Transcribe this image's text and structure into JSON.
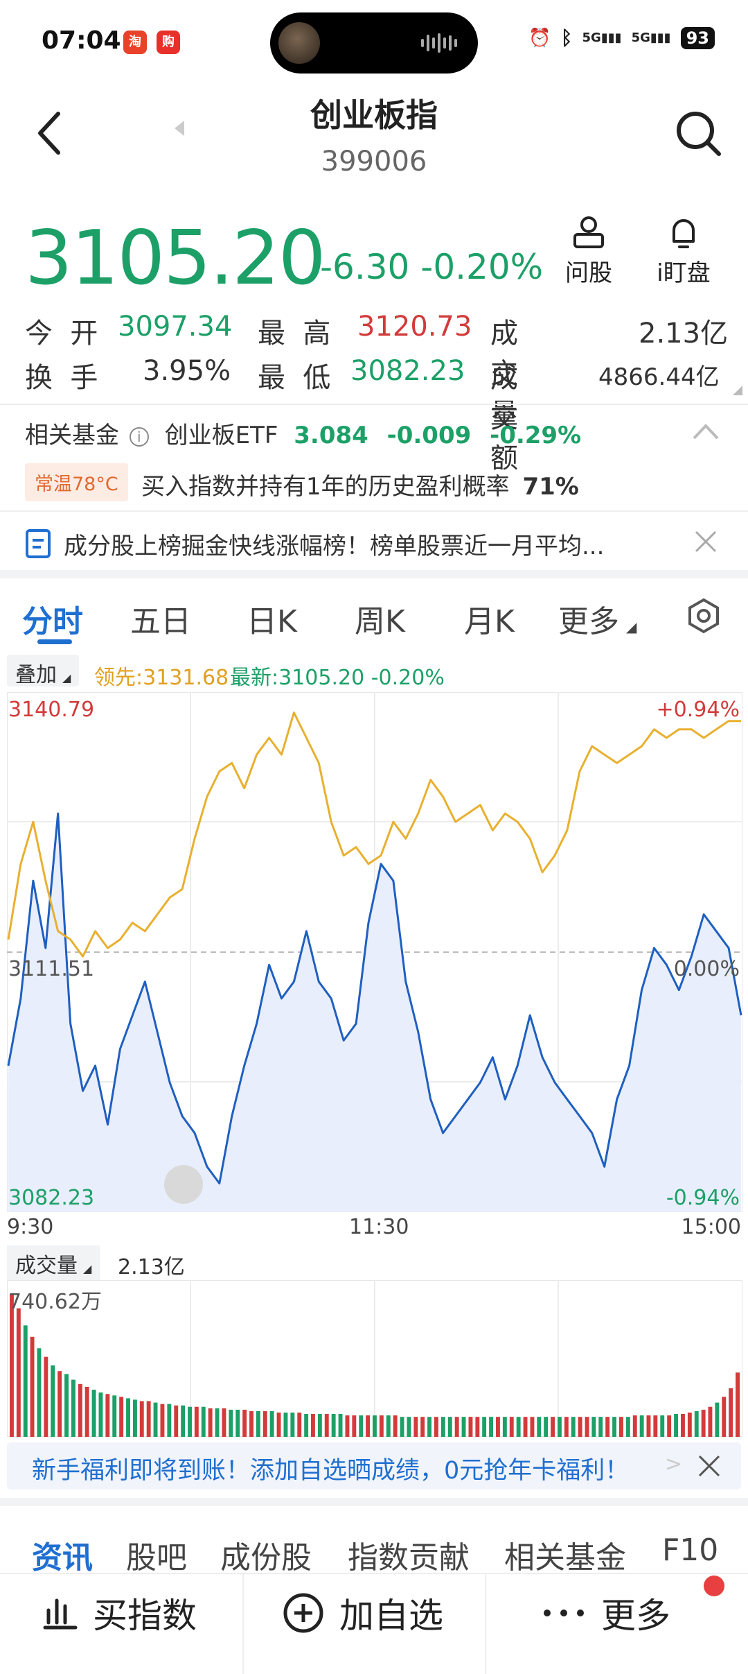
{
  "status": {
    "time": "07:04",
    "battery": "93",
    "signal1": "5G",
    "signal2": "5G"
  },
  "header": {
    "title": "创业板指",
    "code": "399006"
  },
  "quote": {
    "price": "3105.20",
    "change": "-6.30",
    "change_pct": "-0.20%",
    "ask_label": "问股",
    "watch_label": "i盯盘",
    "open_label": "今  开",
    "open": "3097.34",
    "high_label": "最  高",
    "high": "3120.73",
    "volume_label": "成交量",
    "volume": "2.13亿",
    "turnover_label": "换  手",
    "turnover": "3.95%",
    "low_label": "最  低",
    "low": "3082.23",
    "amount_label": "成交额",
    "amount": "4866.44亿"
  },
  "funds": {
    "label": "相关基金",
    "etf_name": "创业板ETF",
    "etf_price": "3.084",
    "etf_change": "-0.009",
    "etf_pct": "-0.29%",
    "temp_badge": "常温78°C",
    "history_text": "买入指数并持有1年的历史盈利概率",
    "history_value": "71%"
  },
  "news_ticker": "成分股上榜掘金快线涨幅榜！榜单股票近一月平均...",
  "tabs": [
    "分时",
    "五日",
    "日K",
    "周K",
    "月K",
    "更多"
  ],
  "chart_header": {
    "overlay": "叠加",
    "lead": "领先:3131.68",
    "latest": "最新:3105.20  -0.20%"
  },
  "chart_data": {
    "type": "line",
    "x_labels": [
      "9:30",
      "11:30",
      "15:00"
    ],
    "y_max_label": "3140.79",
    "y_mid_label": "3111.51",
    "y_min_label": "3082.23",
    "pct_max_label": "+0.94%",
    "pct_mid_label": "0.00%",
    "pct_min_label": "-0.94%",
    "ylim": [
      3082.23,
      3140.79
    ],
    "baseline": 3111.51,
    "series": [
      {
        "name": "最新",
        "color": "#1f5fc0",
        "values": [
          3098,
          3106,
          3120,
          3112,
          3128,
          3103,
          3095,
          3098,
          3091,
          3100,
          3104,
          3108,
          3102,
          3096,
          3092,
          3090,
          3086,
          3084,
          3092,
          3098,
          3103,
          3110,
          3106,
          3108,
          3114,
          3108,
          3106,
          3101,
          3103,
          3115,
          3122,
          3120,
          3108,
          3102,
          3094,
          3090,
          3092,
          3094,
          3096,
          3099,
          3094,
          3098,
          3104,
          3099,
          3096,
          3094,
          3092,
          3090,
          3086,
          3094,
          3098,
          3107,
          3112,
          3110,
          3107,
          3111,
          3116,
          3114,
          3112,
          3104
        ]
      },
      {
        "name": "领先",
        "color": "#e8b030",
        "values": [
          3113,
          3122,
          3127,
          3120,
          3114,
          3113,
          3111,
          3114,
          3112,
          3113,
          3115,
          3114,
          3116,
          3118,
          3119,
          3125,
          3130,
          3133,
          3134,
          3131,
          3135,
          3137,
          3135,
          3140,
          3137,
          3134,
          3127,
          3123,
          3124,
          3122,
          3123,
          3127,
          3125,
          3128,
          3132,
          3130,
          3127,
          3128,
          3129,
          3126,
          3128,
          3127,
          3125,
          3121,
          3123,
          3126,
          3133,
          3136,
          3135,
          3134,
          3135,
          3136,
          3138,
          3137,
          3138,
          3138,
          3137,
          3138,
          3139,
          3139
        ]
      }
    ]
  },
  "volume": {
    "label": "成交量",
    "value": "2.13亿",
    "max_label": "740.62万",
    "values": [
      100,
      90,
      78,
      70,
      62,
      56,
      50,
      46,
      44,
      40,
      37,
      35,
      33,
      31,
      30,
      29,
      28,
      27,
      26,
      25,
      25,
      24,
      23,
      23,
      22,
      22,
      21,
      21,
      21,
      20,
      20,
      20,
      19,
      19,
      19,
      18,
      18,
      18,
      18,
      17,
      17,
      17,
      17,
      16,
      16,
      16,
      16,
      16,
      16,
      15,
      15,
      15,
      15,
      15,
      15,
      15,
      15,
      14,
      14,
      14,
      14,
      14,
      14,
      14,
      14,
      14,
      14,
      14,
      14,
      14,
      14,
      14,
      14,
      14,
      14,
      14,
      14,
      14,
      14,
      14,
      14,
      14,
      14,
      14,
      14,
      14,
      14,
      14,
      14,
      14,
      14,
      15,
      15,
      15,
      15,
      15,
      15,
      16,
      16,
      17,
      18,
      19,
      21,
      24,
      28,
      34,
      45
    ],
    "colors": [
      "r",
      "r",
      "g",
      "r",
      "g",
      "r",
      "g",
      "r",
      "g",
      "g",
      "r",
      "r",
      "g",
      "g",
      "r",
      "g",
      "r",
      "g",
      "g",
      "r",
      "r",
      "g",
      "r",
      "g",
      "r",
      "g",
      "g",
      "r",
      "g",
      "r",
      "g",
      "r",
      "g",
      "g",
      "r",
      "r",
      "g",
      "r",
      "g",
      "r",
      "g",
      "g",
      "r",
      "g",
      "r",
      "g",
      "r",
      "g",
      "g",
      "r",
      "r",
      "g",
      "r",
      "g",
      "r",
      "g",
      "r",
      "g",
      "g",
      "r",
      "r",
      "g",
      "r",
      "g",
      "g",
      "r",
      "g",
      "r",
      "r",
      "g",
      "g",
      "r",
      "g",
      "r",
      "g",
      "r",
      "r",
      "g",
      "g",
      "r",
      "g",
      "r",
      "g",
      "r",
      "r",
      "g",
      "g",
      "r",
      "g",
      "r",
      "g",
      "r",
      "g",
      "r",
      "r",
      "g",
      "r",
      "g",
      "r",
      "r",
      "g",
      "r",
      "r",
      "g",
      "r",
      "r",
      "r"
    ]
  },
  "banner": "新手福利即将到账！添加自选晒成绩，0元抢年卡福利！",
  "bottom_tabs": [
    "资讯",
    "股吧",
    "成份股",
    "指数贡献",
    "相关基金",
    "F10"
  ],
  "actions": {
    "buy": "买指数",
    "add": "加自选",
    "more": "更多"
  },
  "colors": {
    "up": "#d33a3a",
    "down": "#1ca067",
    "accent": "#1f6fd1",
    "lead": "#e0a020"
  }
}
